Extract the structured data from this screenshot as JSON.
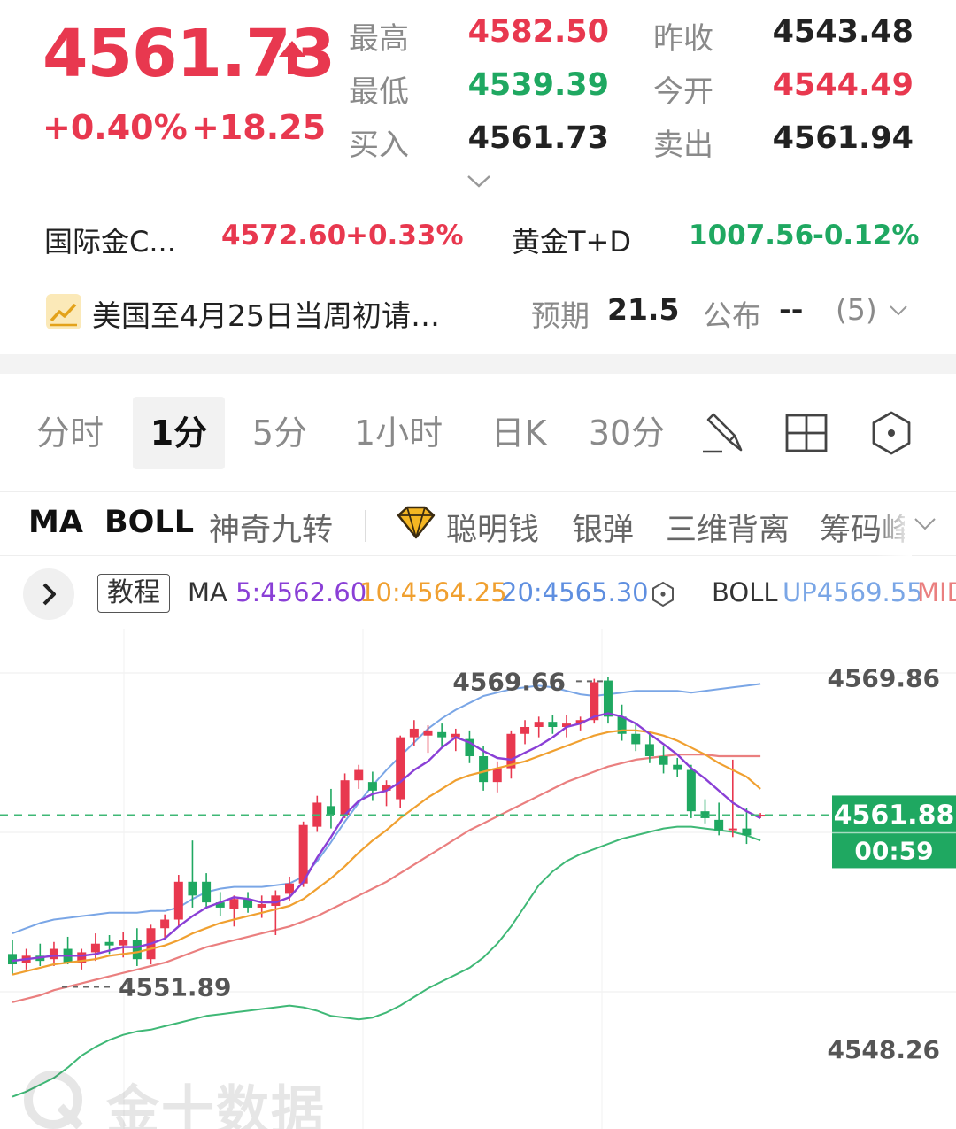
{
  "quote": {
    "last_price": "4561.73",
    "change_pct": "+0.40%",
    "change_abs": "+18.25",
    "stats": [
      {
        "label": "最高",
        "value": "4582.50",
        "tone": "up"
      },
      {
        "label": "昨收",
        "value": "4543.48",
        "tone": "dark"
      },
      {
        "label": "最低",
        "value": "4539.39",
        "tone": "down"
      },
      {
        "label": "今开",
        "value": "4544.49",
        "tone": "up"
      },
      {
        "label": "买入",
        "value": "4561.73",
        "tone": "dark"
      },
      {
        "label": "卖出",
        "value": "4561.94",
        "tone": "dark"
      }
    ]
  },
  "related": [
    {
      "name": "国际金C...",
      "price": "4572.60",
      "change": "+0.33%",
      "tone": "up"
    },
    {
      "name": "黄金T+D",
      "price": "1007.56",
      "change": "-0.12%",
      "tone": "down"
    }
  ],
  "event": {
    "title": "美国至4月25日当周初请…",
    "expect_label": "预期",
    "expect_value": "21.5",
    "publish_label": "公布",
    "publish_value": "--",
    "count": "(5)"
  },
  "period_tabs": [
    "分时",
    "1分",
    "5分",
    "1小时",
    "日K",
    "30分"
  ],
  "active_period": "1分",
  "tool_icons": [
    "draw-pen-icon",
    "grid-layout-icon",
    "hexagon-settings-icon"
  ],
  "indicator_tabs": {
    "main": [
      "MA",
      "BOLL"
    ],
    "others": [
      "神奇九转",
      "聪明钱",
      "银弹",
      "三维背离",
      "筹码峰"
    ]
  },
  "legend": {
    "tutorial_label": "教程",
    "ma_label": "MA",
    "ma5": "5:4562.60",
    "ma10": "10:4564.25",
    "ma20": "20:4565.30",
    "boll_label": "BOLL",
    "boll_up": "UP4569.55",
    "boll_mid": "MID"
  },
  "watermark": "金十数据",
  "colors": {
    "up": "#e8384f",
    "down": "#1fa861",
    "ma5": "#8a3fd6",
    "ma10": "#f0a030",
    "ma20": "#5f8fe0",
    "boll_up": "#7aa6e6",
    "boll_mid": "#ea7f7f",
    "boll_low": "#3fb876"
  },
  "chart_data": {
    "type": "candlestick",
    "interval": "1分",
    "y_axis_labels": [
      "4569.86",
      "4548.26"
    ],
    "ylim": [
      4544.5,
      4572.2
    ],
    "current_price": "4561.88",
    "countdown": "00:59",
    "max_marker": "4569.66",
    "min_marker": "4551.89",
    "candles": [
      {
        "o": 4553.8,
        "h": 4554.6,
        "l": 4552.6,
        "c": 4553.2
      },
      {
        "o": 4553.3,
        "h": 4554.1,
        "l": 4552.9,
        "c": 4553.7
      },
      {
        "o": 4553.7,
        "h": 4554.4,
        "l": 4553.1,
        "c": 4553.4
      },
      {
        "o": 4553.5,
        "h": 4554.5,
        "l": 4553.1,
        "c": 4554.1
      },
      {
        "o": 4554.1,
        "h": 4554.8,
        "l": 4553.2,
        "c": 4553.3
      },
      {
        "o": 4553.3,
        "h": 4554.1,
        "l": 4552.9,
        "c": 4553.9
      },
      {
        "o": 4553.9,
        "h": 4555.0,
        "l": 4553.4,
        "c": 4554.4
      },
      {
        "o": 4554.5,
        "h": 4554.9,
        "l": 4553.8,
        "c": 4554.3
      },
      {
        "o": 4554.3,
        "h": 4555.1,
        "l": 4553.6,
        "c": 4554.6
      },
      {
        "o": 4554.6,
        "h": 4555.3,
        "l": 4553.1,
        "c": 4553.5
      },
      {
        "o": 4553.5,
        "h": 4555.5,
        "l": 4553.2,
        "c": 4555.3
      },
      {
        "o": 4555.3,
        "h": 4556.1,
        "l": 4554.7,
        "c": 4555.8
      },
      {
        "o": 4555.8,
        "h": 4558.4,
        "l": 4555.4,
        "c": 4558.0
      },
      {
        "o": 4558.0,
        "h": 4560.4,
        "l": 4556.5,
        "c": 4557.2
      },
      {
        "o": 4558.0,
        "h": 4558.5,
        "l": 4556.4,
        "c": 4556.8
      },
      {
        "o": 4556.8,
        "h": 4557.4,
        "l": 4556.0,
        "c": 4556.5
      },
      {
        "o": 4556.4,
        "h": 4557.2,
        "l": 4555.4,
        "c": 4557.0
      },
      {
        "o": 4557.0,
        "h": 4557.4,
        "l": 4556.2,
        "c": 4556.5
      },
      {
        "o": 4556.5,
        "h": 4557.2,
        "l": 4555.9,
        "c": 4556.7
      },
      {
        "o": 4556.6,
        "h": 4557.5,
        "l": 4554.9,
        "c": 4557.2
      },
      {
        "o": 4557.3,
        "h": 4558.3,
        "l": 4556.9,
        "c": 4557.9
      },
      {
        "o": 4557.9,
        "h": 4561.5,
        "l": 4557.7,
        "c": 4561.3
      },
      {
        "o": 4561.2,
        "h": 4563.0,
        "l": 4560.9,
        "c": 4562.6
      },
      {
        "o": 4562.4,
        "h": 4563.4,
        "l": 4561.1,
        "c": 4561.9
      },
      {
        "o": 4561.9,
        "h": 4564.3,
        "l": 4561.7,
        "c": 4563.9
      },
      {
        "o": 4563.9,
        "h": 4564.8,
        "l": 4563.4,
        "c": 4564.5
      },
      {
        "o": 4563.8,
        "h": 4564.4,
        "l": 4562.7,
        "c": 4563.3
      },
      {
        "o": 4563.3,
        "h": 4563.9,
        "l": 4562.4,
        "c": 4563.6
      },
      {
        "o": 4562.8,
        "h": 4566.5,
        "l": 4562.3,
        "c": 4566.4
      },
      {
        "o": 4566.4,
        "h": 4567.4,
        "l": 4565.9,
        "c": 4566.9
      },
      {
        "o": 4566.5,
        "h": 4567.1,
        "l": 4565.5,
        "c": 4566.8
      },
      {
        "o": 4566.7,
        "h": 4567.2,
        "l": 4565.8,
        "c": 4566.4
      },
      {
        "o": 4566.4,
        "h": 4566.9,
        "l": 4565.6,
        "c": 4566.6
      },
      {
        "o": 4566.3,
        "h": 4566.8,
        "l": 4564.9,
        "c": 4565.3
      },
      {
        "o": 4565.3,
        "h": 4565.9,
        "l": 4563.3,
        "c": 4563.8
      },
      {
        "o": 4563.8,
        "h": 4565.0,
        "l": 4563.2,
        "c": 4564.6
      },
      {
        "o": 4564.6,
        "h": 4566.8,
        "l": 4564.0,
        "c": 4566.6
      },
      {
        "o": 4566.6,
        "h": 4567.4,
        "l": 4566.0,
        "c": 4567.0
      },
      {
        "o": 4567.0,
        "h": 4567.6,
        "l": 4566.4,
        "c": 4567.3
      },
      {
        "o": 4567.3,
        "h": 4567.7,
        "l": 4566.6,
        "c": 4567.0
      },
      {
        "o": 4567.0,
        "h": 4567.7,
        "l": 4566.4,
        "c": 4567.2
      },
      {
        "o": 4567.2,
        "h": 4567.6,
        "l": 4566.8,
        "c": 4567.4
      },
      {
        "o": 4567.4,
        "h": 4569.8,
        "l": 4567.2,
        "c": 4569.6
      },
      {
        "o": 4569.7,
        "h": 4569.9,
        "l": 4567.2,
        "c": 4567.6
      },
      {
        "o": 4567.6,
        "h": 4568.3,
        "l": 4566.2,
        "c": 4566.6
      },
      {
        "o": 4566.6,
        "h": 4567.2,
        "l": 4565.6,
        "c": 4566.0
      },
      {
        "o": 4566.0,
        "h": 4566.6,
        "l": 4564.9,
        "c": 4565.3
      },
      {
        "o": 4565.3,
        "h": 4565.9,
        "l": 4564.3,
        "c": 4564.8
      },
      {
        "o": 4564.8,
        "h": 4565.2,
        "l": 4564.1,
        "c": 4564.5
      },
      {
        "o": 4564.5,
        "h": 4564.8,
        "l": 4561.7,
        "c": 4562.1
      },
      {
        "o": 4562.1,
        "h": 4562.8,
        "l": 4561.4,
        "c": 4561.7
      },
      {
        "o": 4561.6,
        "h": 4562.6,
        "l": 4560.7,
        "c": 4561.0
      },
      {
        "o": 4561.0,
        "h": 4565.1,
        "l": 4560.6,
        "c": 4561.1
      },
      {
        "o": 4561.1,
        "h": 4562.3,
        "l": 4560.2,
        "c": 4560.7
      },
      {
        "o": 4561.9,
        "h": 4562.0,
        "l": 4561.7,
        "c": 4561.9
      }
    ],
    "series": [
      {
        "name": "MA5",
        "values": [
          4553.4,
          4553.5,
          4553.6,
          4553.7,
          4553.7,
          4553.7,
          4553.8,
          4554.0,
          4554.2,
          4554.2,
          4554.4,
          4554.7,
          4555.4,
          4556.0,
          4556.5,
          4556.8,
          4557.1,
          4557.0,
          4556.8,
          4556.8,
          4557.1,
          4558.0,
          4559.4,
          4560.6,
          4561.9,
          4562.7,
          4563.1,
          4563.3,
          4563.8,
          4564.5,
          4565.0,
          4565.8,
          4566.4,
          4566.1,
          4565.6,
          4565.2,
          4565.1,
          4565.5,
          4565.9,
          4566.4,
          4567.0,
          4567.2,
          4567.6,
          4567.8,
          4567.6,
          4567.2,
          4566.6,
          4566.0,
          4565.4,
          4564.6,
          4564.0,
          4563.3,
          4562.6,
          4562.1,
          4561.7
        ]
      },
      {
        "name": "MA10",
        "values": [
          4552.6,
          4552.8,
          4553.0,
          4553.2,
          4553.3,
          4553.4,
          4553.5,
          4553.7,
          4553.8,
          4553.9,
          4554.1,
          4554.3,
          4554.6,
          4555.0,
          4555.3,
          4555.6,
          4555.8,
          4556.0,
          4556.2,
          4556.4,
          4556.6,
          4557.0,
          4557.6,
          4558.2,
          4558.9,
          4559.7,
          4560.4,
          4561.0,
          4561.7,
          4562.3,
          4562.9,
          4563.4,
          4563.9,
          4564.2,
          4564.4,
          4564.6,
          4564.8,
          4565.0,
          4565.3,
          4565.6,
          4565.9,
          4566.2,
          4566.5,
          4566.7,
          4566.8,
          4566.8,
          4566.7,
          4566.5,
          4566.2,
          4565.8,
          4565.4,
          4564.9,
          4564.5,
          4564.1,
          4563.4
        ]
      },
      {
        "name": "MA20",
        "values": [
          4551.0,
          4551.2,
          4551.4,
          4551.7,
          4551.9,
          4552.1,
          4552.3,
          4552.5,
          4552.7,
          4552.9,
          4553.1,
          4553.3,
          4553.6,
          4553.9,
          4554.2,
          4554.4,
          4554.6,
          4554.8,
          4555.0,
          4555.2,
          4555.4,
          4555.7,
          4556.0,
          4556.4,
          4556.8,
          4557.2,
          4557.6,
          4558.0,
          4558.5,
          4559.0,
          4559.5,
          4560.0,
          4560.5,
          4561.0,
          4561.4,
          4561.8,
          4562.2,
          4562.6,
          4563.0,
          4563.4,
          4563.8,
          4564.1,
          4564.4,
          4564.7,
          4564.9,
          4565.1,
          4565.2,
          4565.3,
          4565.4,
          4565.4,
          4565.4,
          4565.3,
          4565.3,
          4565.3,
          4565.3
        ]
      },
      {
        "name": "BOLL UP",
        "values": [
          4555.0,
          4555.3,
          4555.6,
          4555.8,
          4555.9,
          4556.0,
          4556.1,
          4556.2,
          4556.2,
          4556.2,
          4556.3,
          4556.3,
          4556.5,
          4557.0,
          4557.4,
          4557.6,
          4557.7,
          4557.7,
          4557.7,
          4557.8,
          4557.9,
          4558.3,
          4559.2,
          4560.3,
          4561.5,
          4562.6,
          4563.6,
          4564.5,
          4565.3,
          4566.1,
          4566.9,
          4567.5,
          4568.0,
          4568.4,
          4568.8,
          4569.0,
          4569.2,
          4569.3,
          4569.4,
          4569.3,
          4569.1,
          4568.9,
          4568.8,
          4568.9,
          4569.0,
          4569.1,
          4569.1,
          4569.1,
          4569.1,
          4569.0,
          4569.1,
          4569.2,
          4569.3,
          4569.4,
          4569.5
        ]
      },
      {
        "name": "BOLL MID",
        "values": [
          4551.0,
          4551.2,
          4551.4,
          4551.7,
          4551.9,
          4552.1,
          4552.3,
          4552.5,
          4552.7,
          4552.9,
          4553.1,
          4553.3,
          4553.6,
          4553.9,
          4554.2,
          4554.4,
          4554.6,
          4554.8,
          4555.0,
          4555.2,
          4555.4,
          4555.7,
          4556.0,
          4556.4,
          4556.8,
          4557.2,
          4557.6,
          4558.0,
          4558.5,
          4559.0,
          4559.5,
          4560.0,
          4560.5,
          4561.0,
          4561.4,
          4561.8,
          4562.2,
          4562.6,
          4563.0,
          4563.4,
          4563.8,
          4564.1,
          4564.4,
          4564.7,
          4564.9,
          4565.1,
          4565.2,
          4565.3,
          4565.4,
          4565.4,
          4565.4,
          4565.3,
          4565.3,
          4565.3,
          4565.3
        ]
      },
      {
        "name": "BOLL LOW",
        "values": [
          4545.5,
          4545.8,
          4546.2,
          4546.6,
          4547.2,
          4547.9,
          4548.4,
          4548.8,
          4549.1,
          4549.3,
          4549.4,
          4549.6,
          4549.8,
          4550.0,
          4550.2,
          4550.3,
          4550.4,
          4550.5,
          4550.6,
          4550.7,
          4550.8,
          4550.7,
          4550.5,
          4550.2,
          4550.1,
          4550.0,
          4550.1,
          4550.4,
          4550.8,
          4551.3,
          4551.8,
          4552.2,
          4552.6,
          4553.0,
          4553.6,
          4554.4,
          4555.4,
          4556.6,
          4557.8,
          4558.6,
          4559.2,
          4559.6,
          4559.9,
          4560.2,
          4560.5,
          4560.7,
          4560.9,
          4561.1,
          4561.2,
          4561.2,
          4561.1,
          4561.0,
          4560.9,
          4560.7,
          4560.4
        ]
      }
    ]
  }
}
